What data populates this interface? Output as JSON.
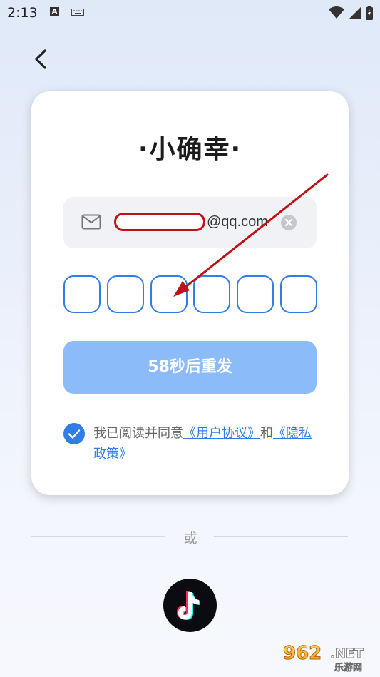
{
  "status_bar": {
    "time": "2:13",
    "notification_icons": [
      "A",
      "keyboard-icon"
    ],
    "system_icons": [
      "wifi-icon",
      "cell-signal-icon",
      "battery-charging-icon"
    ]
  },
  "header": {
    "back_icon": "chevron-left-icon"
  },
  "login_card": {
    "app_title": "·小确幸·",
    "email": {
      "icon": "mail-icon",
      "value_suffix": "@qq.com",
      "redacted_prefix": true,
      "clear_icon": "clear-icon"
    },
    "verification_code": {
      "boxes": [
        "",
        "",
        "",
        "",
        "",
        ""
      ]
    },
    "resend_button_label": "58秒后重发",
    "agreement": {
      "checked": true,
      "prefix_text": "我已阅读并同意",
      "user_agreement_link": "《用户协议》",
      "conjunction": "和",
      "privacy_policy_link": "《隐私政策》"
    }
  },
  "alternate_login": {
    "divider_text": "或",
    "options": [
      {
        "icon": "tiktok-icon"
      }
    ]
  },
  "watermark": {
    "text": "962.NET",
    "subtext": "乐游网"
  },
  "colors": {
    "accent": "#2f7de5",
    "button_disabled": "#8cbbf9",
    "annotation_arrow": "#c40f14",
    "tiktok_bg": "#0b0b12"
  }
}
